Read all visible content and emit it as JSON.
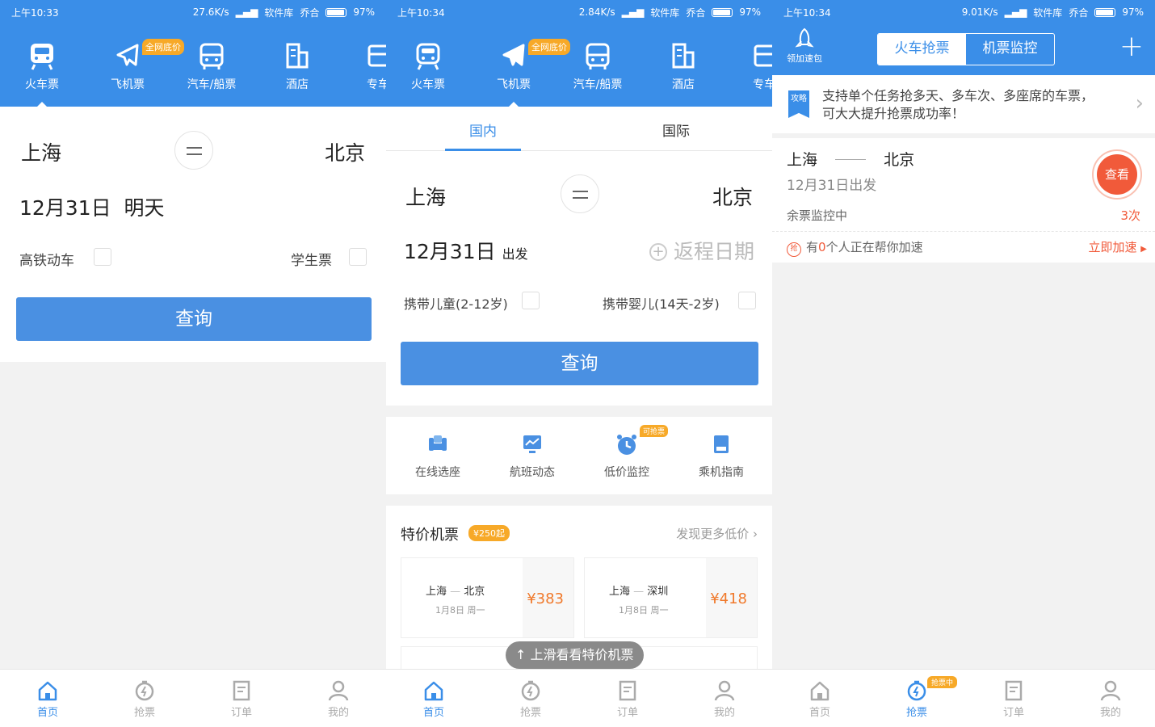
{
  "colors": {
    "primary": "#3a8ee8",
    "button": "#4a90e2",
    "orange": "#f7a928",
    "red": "#f15a3a",
    "text": "#333333"
  },
  "screen1": {
    "status": {
      "time": "上午10:33",
      "speed": "27.6K/s",
      "carrier1": "软件库",
      "carrier2": "乔合",
      "battery": "97%"
    },
    "nav": {
      "badge": "全网底价",
      "items": [
        {
          "label": "火车票",
          "icon": "train-icon"
        },
        {
          "label": "飞机票",
          "icon": "plane-icon"
        },
        {
          "label": "汽车/船票",
          "icon": "bus-icon"
        },
        {
          "label": "酒店",
          "icon": "hotel-icon"
        },
        {
          "label": "专车",
          "icon": "car-icon"
        }
      ]
    },
    "from": "上海",
    "to": "北京",
    "date": "12月31日",
    "date_suffix": "明天",
    "option1": "高铁动车",
    "option2": "学生票",
    "search": "查询",
    "tabs": [
      "首页",
      "抢票",
      "订单",
      "我的"
    ]
  },
  "screen2": {
    "status": {
      "time": "上午10:34",
      "speed": "2.84K/s",
      "carrier1": "软件库",
      "carrier2": "乔合",
      "battery": "97%"
    },
    "nav": {
      "badge": "全网底价",
      "items": [
        {
          "label": "火车票",
          "icon": "train-icon"
        },
        {
          "label": "飞机票",
          "icon": "plane-icon"
        },
        {
          "label": "汽车/船票",
          "icon": "bus-icon"
        },
        {
          "label": "酒店",
          "icon": "hotel-icon"
        },
        {
          "label": "专车",
          "icon": "car-icon"
        }
      ]
    },
    "segment": {
      "domestic": "国内",
      "international": "国际"
    },
    "from": "上海",
    "to": "北京",
    "date": "12月31日",
    "date_suffix": "出发",
    "return": "返程日期",
    "option1": "携带儿童(2-12岁)",
    "option2": "携带婴儿(14天-2岁)",
    "search": "查询",
    "services": [
      {
        "label": "在线选座",
        "icon": "seat-icon"
      },
      {
        "label": "航班动态",
        "icon": "flight-status-icon"
      },
      {
        "label": "低价监控",
        "icon": "alarm-icon",
        "badge": "可抢票"
      },
      {
        "label": "乘机指南",
        "icon": "guide-icon"
      }
    ],
    "deals": {
      "title": "特价机票",
      "tag": "¥250起",
      "more": "发现更多低价",
      "cards": [
        {
          "from": "上海",
          "to": "北京",
          "date": "1月8日 周一",
          "price": "¥383"
        },
        {
          "from": "上海",
          "to": "深圳",
          "date": "1月8日 周一",
          "price": "¥418"
        }
      ]
    },
    "toast": "上滑看看特价机票",
    "tabs": [
      "首页",
      "抢票",
      "订单",
      "我的"
    ]
  },
  "screen3": {
    "status": {
      "time": "上午10:34",
      "speed": "9.01K/s",
      "carrier1": "软件库",
      "carrier2": "乔合",
      "battery": "97%"
    },
    "header": {
      "speed_pack": "领加速包",
      "tab_train": "火车抢票",
      "tab_flight": "机票监控",
      "plus": "+"
    },
    "tip": {
      "badge": "攻略",
      "text1": "支持单个任务抢多天、多车次、多座席的车票，",
      "text2": "可大大提升抢票成功率！"
    },
    "task": {
      "from": "上海",
      "to": "北京",
      "date": "12月31日出发",
      "view": "查看",
      "monitor": "余票监控中",
      "count": "3次",
      "help_prefix": "有",
      "help_count": "0",
      "help_suffix": "个人正在帮你加速",
      "accelerate": "立即加速",
      "accelerate_icon": "抢"
    },
    "tab_badge": "抢票中",
    "tabs": [
      "首页",
      "抢票",
      "订单",
      "我的"
    ]
  }
}
